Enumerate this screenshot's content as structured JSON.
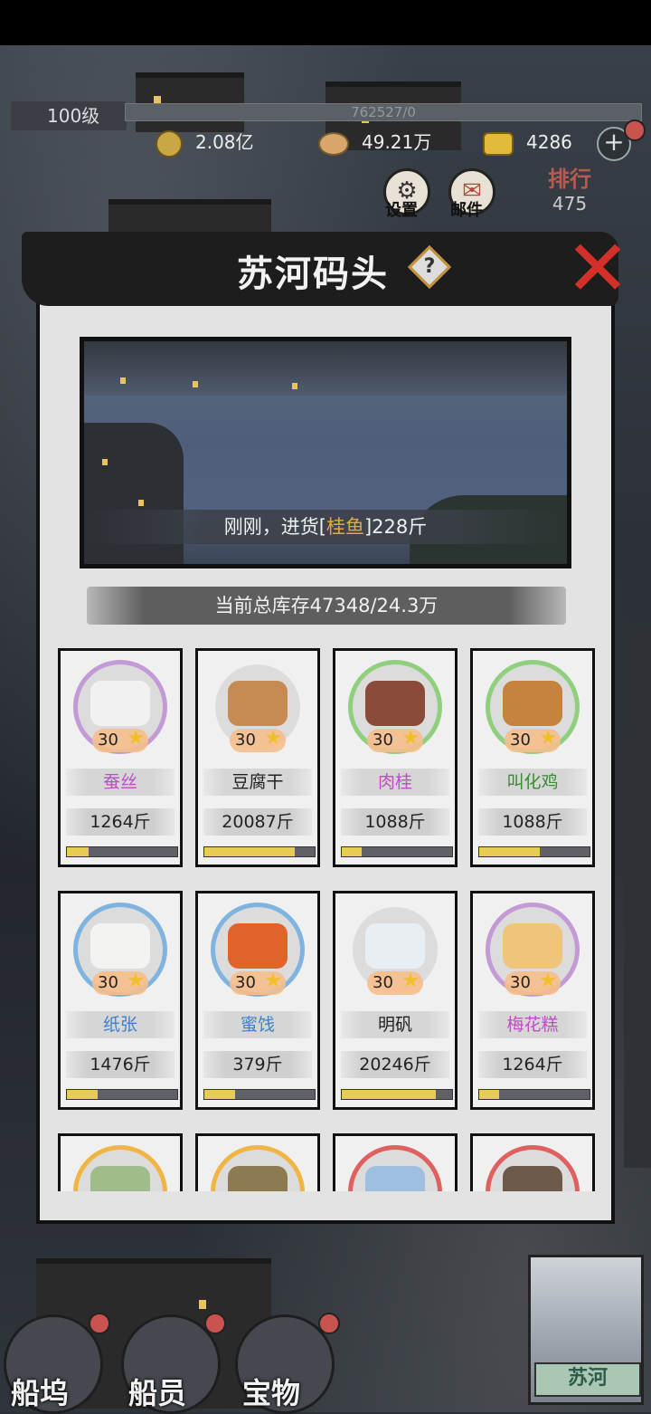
{
  "hud": {
    "level": "100级",
    "exp": "762527/0",
    "copper": "2.08亿",
    "shell": "49.21万",
    "gold": "4286",
    "plus": "+",
    "settings": "设置",
    "mail": "邮件",
    "rank_label": "排行",
    "rank_value": "475"
  },
  "panel": {
    "title": "苏河码头",
    "help": "?",
    "close": "✕",
    "caption_prefix": "刚刚，进货[",
    "caption_item": "桂鱼",
    "caption_suffix": "]228斤",
    "stock": "当前总库存47348/24.3万"
  },
  "items": [
    {
      "name": "蚕丝",
      "level": "30",
      "qty": "1264斤",
      "fill": 0.2,
      "name_color": "#c04bc4",
      "ring": "#c39ad6",
      "item_color": "#f1f1f1"
    },
    {
      "name": "豆腐干",
      "level": "30",
      "qty": "20087斤",
      "fill": 0.82,
      "name_color": "#222222",
      "ring": "#f0f0f0",
      "item_color": "#c78a52"
    },
    {
      "name": "肉桂",
      "level": "30",
      "qty": "1088斤",
      "fill": 0.18,
      "name_color": "#c04bc4",
      "ring": "#8fcf7e",
      "item_color": "#8a4b3a"
    },
    {
      "name": "叫化鸡",
      "level": "30",
      "qty": "1088斤",
      "fill": 0.55,
      "name_color": "#3c8a34",
      "ring": "#8fcf7e",
      "item_color": "#c5833d"
    },
    {
      "name": "纸张",
      "level": "30",
      "qty": "1476斤",
      "fill": 0.28,
      "name_color": "#3f82c8",
      "ring": "#7fb4e0",
      "item_color": "#f3f3f1"
    },
    {
      "name": "蜜饯",
      "level": "30",
      "qty": "379斤",
      "fill": 0.28,
      "name_color": "#3f82c8",
      "ring": "#7fb4e0",
      "item_color": "#e2622b"
    },
    {
      "name": "明矾",
      "level": "30",
      "qty": "20246斤",
      "fill": 0.85,
      "name_color": "#222222",
      "ring": "#f0f0f0",
      "item_color": "#e9eef3"
    },
    {
      "name": "梅花糕",
      "level": "30",
      "qty": "1264斤",
      "fill": 0.18,
      "name_color": "#c04bc4",
      "ring": "#c39ad6",
      "item_color": "#efc47b"
    },
    {
      "name": "",
      "level": "",
      "qty": "",
      "fill": 0,
      "name_color": "#222222",
      "ring": "#f0b545",
      "item_color": "#9fbc8a"
    },
    {
      "name": "",
      "level": "",
      "qty": "",
      "fill": 0,
      "name_color": "#222222",
      "ring": "#f0b545",
      "item_color": "#8e7a50"
    },
    {
      "name": "",
      "level": "",
      "qty": "",
      "fill": 0,
      "name_color": "#222222",
      "ring": "#e06060",
      "item_color": "#9fbfe0"
    },
    {
      "name": "",
      "level": "",
      "qty": "",
      "fill": 0,
      "name_color": "#222222",
      "ring": "#e06060",
      "item_color": "#6d5a4a"
    }
  ],
  "nav": {
    "dock": "船坞",
    "crew": "船员",
    "treasure": "宝物",
    "map_label": "苏河"
  }
}
